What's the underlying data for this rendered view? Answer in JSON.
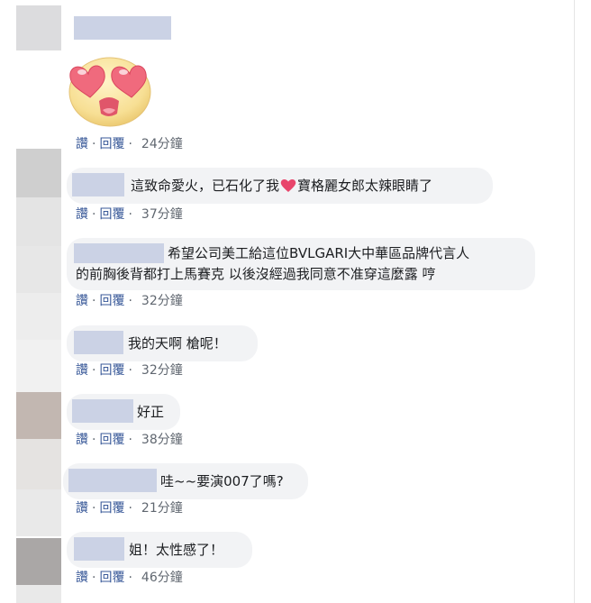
{
  "colors": {
    "link": "#385898",
    "muted": "#606770",
    "bubble": "#f2f3f5",
    "name_blur": "#cbd2e5",
    "heart": "#e8456b"
  },
  "comments": [
    {
      "text": "",
      "sticker": "heart-eyes-emoji",
      "like": "讚",
      "reply": "回覆",
      "time": "24分鐘"
    },
    {
      "text_before": "這致命愛火，已石化了我",
      "icon": "heart-icon",
      "text_after": "寶格麗女郎太辣眼睛了",
      "like": "讚",
      "reply": "回覆",
      "time": "37分鐘"
    },
    {
      "line1": "希望公司美工給這位BVLGARI大中華區品牌代言人",
      "line2": "的前胸後背都打上馬賽克 以後沒經過我同意不准穿這麼露 哼",
      "like": "讚",
      "reply": "回覆",
      "time": "32分鐘"
    },
    {
      "text": "我的天啊 槍呢！",
      "like": "讚",
      "reply": "回覆",
      "time": "32分鐘"
    },
    {
      "text": "好正",
      "like": "讚",
      "reply": "回覆",
      "time": "38分鐘"
    },
    {
      "text": "哇~~要演007了嗎?",
      "like": "讚",
      "reply": "回覆",
      "time": "21分鐘"
    },
    {
      "text": "姐！太性感了！",
      "like": "讚",
      "reply": "回覆",
      "time": "46分鐘"
    }
  ]
}
